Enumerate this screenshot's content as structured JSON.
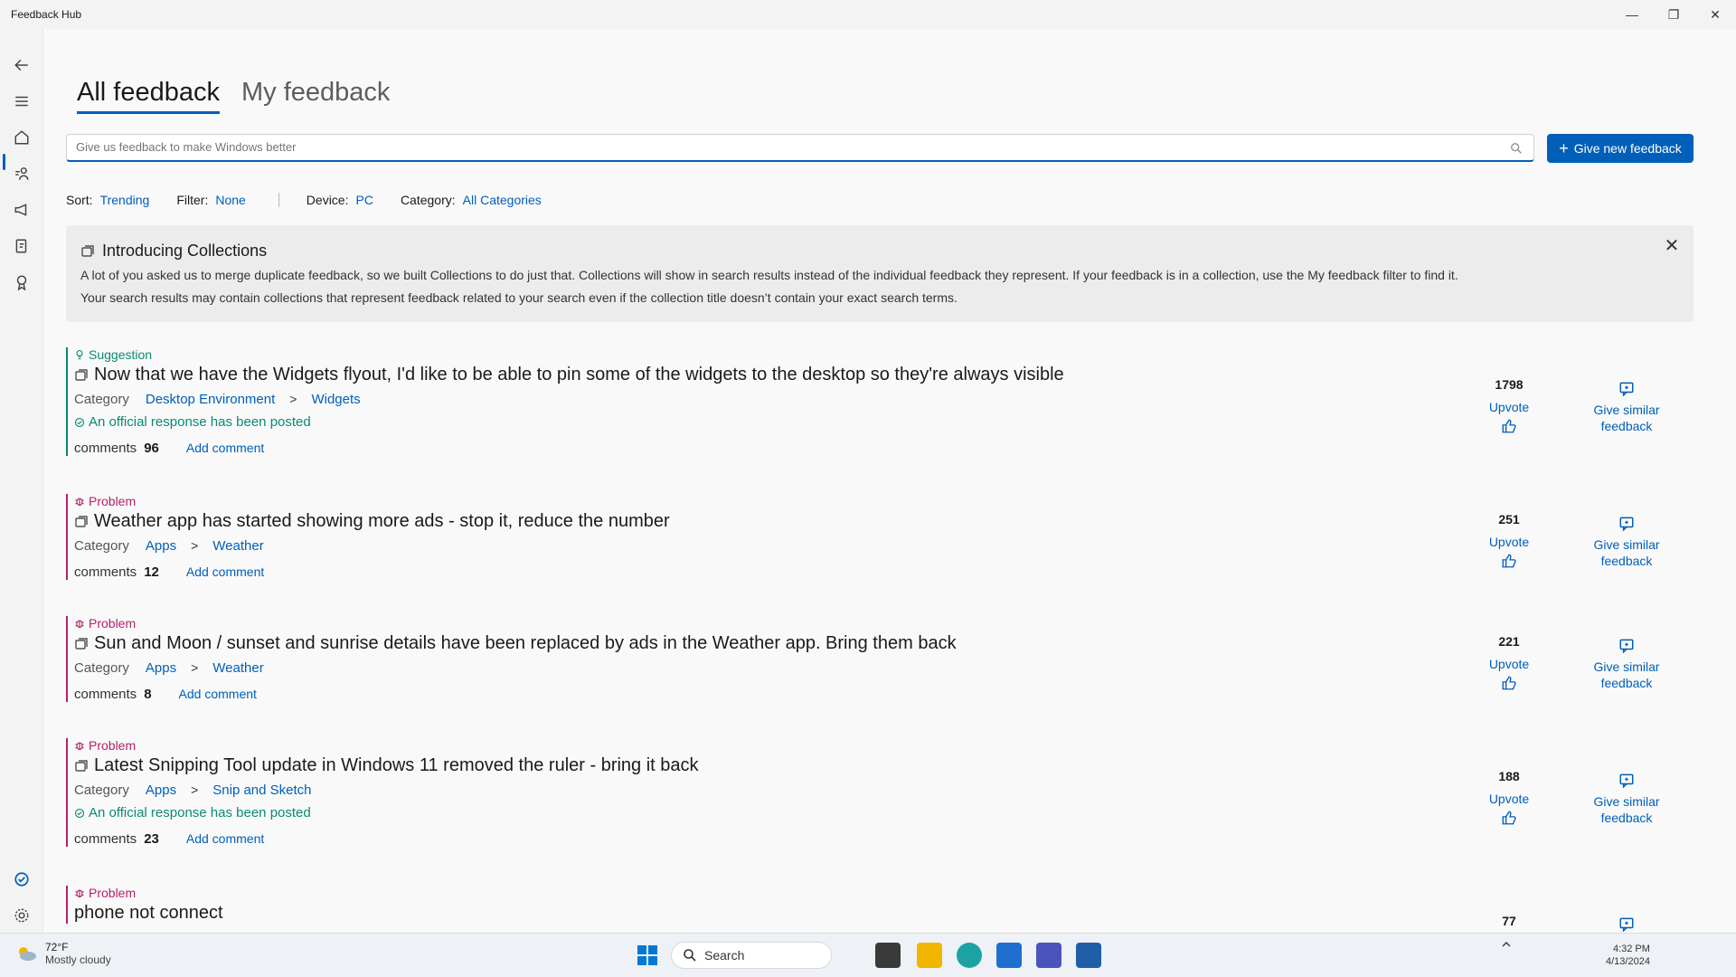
{
  "window": {
    "title": "Feedback Hub"
  },
  "tabs": [
    {
      "label": "All feedback",
      "active": true
    },
    {
      "label": "My feedback",
      "active": false
    }
  ],
  "search": {
    "placeholder": "Give us feedback to make Windows better"
  },
  "new_feedback_label": "Give new feedback",
  "filters": {
    "sort_label": "Sort:",
    "sort_value": "Trending",
    "filter_label": "Filter:",
    "filter_value": "None",
    "device_label": "Device:",
    "device_value": "PC",
    "category_label": "Category:",
    "category_value": "All Categories"
  },
  "info": {
    "title": "Introducing Collections",
    "line1": "A lot of you asked us to merge duplicate feedback, so we built Collections to do just that. Collections will show in search results instead of the individual feedback they represent. If your feedback is in a collection, use the My feedback filter to find it.",
    "line2": "Your search results may contain collections that represent feedback related to your search even if the collection title doesn’t contain your exact search terms."
  },
  "card_labels": {
    "category": "Category",
    "comments": "comments",
    "add_comment": "Add comment",
    "official": "An official response has been posted",
    "upvote": "Upvote",
    "similar_line1": "Give similar",
    "similar_line2": "feedback"
  },
  "feedback": [
    {
      "type": "Suggestion",
      "title": "Now that we have the Widgets flyout, I'd like to be able to pin some of the widgets to the desktop so they're always visible",
      "cat1": "Desktop Environment",
      "cat2": "Widgets",
      "official": true,
      "comments": "96",
      "votes": "1798"
    },
    {
      "type": "Problem",
      "title": "Weather app has started showing more ads - stop it, reduce the number",
      "cat1": "Apps",
      "cat2": "Weather",
      "official": false,
      "comments": "12",
      "votes": "251"
    },
    {
      "type": "Problem",
      "title": "Sun and Moon / sunset and sunrise details have been replaced by ads in the Weather app. Bring them back",
      "cat1": "Apps",
      "cat2": "Weather",
      "official": false,
      "comments": "8",
      "votes": "221"
    },
    {
      "type": "Problem",
      "title": "Latest Snipping Tool update in Windows 11 removed the ruler - bring it back",
      "cat1": "Apps",
      "cat2": "Snip and Sketch",
      "official": true,
      "comments": "23",
      "votes": "188"
    },
    {
      "type": "Problem",
      "title": "phone not connect",
      "votes": "77"
    }
  ],
  "taskbar": {
    "temp": "72°F",
    "condition": "Mostly cloudy",
    "search_label": "Search",
    "time": "4:32 PM",
    "date": "4/13/2024"
  },
  "colors": {
    "accent": "#005fb8",
    "suggestion": "#0a8a72",
    "problem": "#b4206c"
  }
}
